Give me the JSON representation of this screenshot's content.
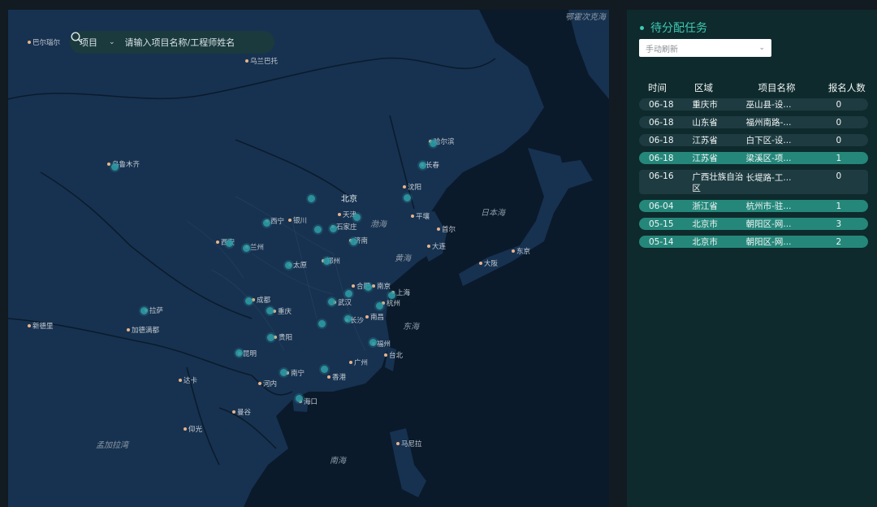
{
  "search": {
    "type_label": "项目",
    "placeholder": "请输入项目名称/工程师姓名"
  },
  "panel": {
    "title": "待分配任务",
    "refresh_select": "手动刷新",
    "columns": [
      "时间",
      "区域",
      "项目名称",
      "报名人数"
    ],
    "rows": [
      {
        "date": "06-18",
        "region": "重庆市",
        "project": "巫山县-设...",
        "count": "0",
        "highlight": false
      },
      {
        "date": "06-18",
        "region": "山东省",
        "project": "福州南路-...",
        "count": "0",
        "highlight": false
      },
      {
        "date": "06-18",
        "region": "江苏省",
        "project": "白下区-设...",
        "count": "0",
        "highlight": false
      },
      {
        "date": "06-18",
        "region": "江苏省",
        "project": "梁溪区-项...",
        "count": "1",
        "highlight": true
      },
      {
        "date": "06-16",
        "region": "广西壮族自治区",
        "project": "长堤路-工...",
        "count": "0",
        "highlight": false
      },
      {
        "date": "06-04",
        "region": "浙江省",
        "project": "杭州市-驻...",
        "count": "1",
        "highlight": true
      },
      {
        "date": "05-15",
        "region": "北京市",
        "project": "朝阳区-网...",
        "count": "3",
        "highlight": true
      },
      {
        "date": "05-14",
        "region": "北京市",
        "project": "朝阳区-网...",
        "count": "2",
        "highlight": true
      }
    ]
  },
  "map": {
    "labels": [
      {
        "text": "巴尔瑙尔",
        "dot": true
      },
      {
        "text": "乌兰巴托",
        "dot": true
      },
      {
        "text": "乌鲁木齐",
        "dot": true
      },
      {
        "text": "北京",
        "dot": false,
        "capital": true
      },
      {
        "text": "天津",
        "dot": true
      },
      {
        "text": "石家庄",
        "dot": true
      },
      {
        "text": "哈尔滨",
        "dot": true
      },
      {
        "text": "长春",
        "dot": true
      },
      {
        "text": "沈阳",
        "dot": true
      },
      {
        "text": "大连",
        "dot": true
      },
      {
        "text": "平壤",
        "dot": true
      },
      {
        "text": "首尔",
        "dot": true
      },
      {
        "text": "东京",
        "dot": true
      },
      {
        "text": "大阪",
        "dot": true
      },
      {
        "text": "济南",
        "dot": true
      },
      {
        "text": "郑州",
        "dot": true
      },
      {
        "text": "太原",
        "dot": true
      },
      {
        "text": "西安",
        "dot": true
      },
      {
        "text": "兰州",
        "dot": true
      },
      {
        "text": "西宁",
        "dot": true
      },
      {
        "text": "银川",
        "dot": true
      },
      {
        "text": "合肥",
        "dot": true
      },
      {
        "text": "南京",
        "dot": true
      },
      {
        "text": "上海",
        "dot": true
      },
      {
        "text": "杭州",
        "dot": true
      },
      {
        "text": "武汉",
        "dot": true
      },
      {
        "text": "成都",
        "dot": true
      },
      {
        "text": "重庆",
        "dot": true
      },
      {
        "text": "长沙",
        "dot": true
      },
      {
        "text": "南昌",
        "dot": true
      },
      {
        "text": "福州",
        "dot": true
      },
      {
        "text": "贵阳",
        "dot": true
      },
      {
        "text": "昆明",
        "dot": true
      },
      {
        "text": "南宁",
        "dot": true
      },
      {
        "text": "广州",
        "dot": true
      },
      {
        "text": "香港",
        "dot": true
      },
      {
        "text": "海口",
        "dot": true
      },
      {
        "text": "拉萨",
        "dot": true
      },
      {
        "text": "台北",
        "dot": true
      },
      {
        "text": "河内",
        "dot": true
      },
      {
        "text": "曼谷",
        "dot": true
      },
      {
        "text": "马尼拉",
        "dot": true
      },
      {
        "text": "加德满都",
        "dot": true
      },
      {
        "text": "新德里",
        "dot": true
      },
      {
        "text": "达卡",
        "dot": true
      },
      {
        "text": "仰光",
        "dot": true
      },
      {
        "text": "渤海",
        "dot": false,
        "big": true
      },
      {
        "text": "黄海",
        "dot": false,
        "big": true
      },
      {
        "text": "东海",
        "dot": false,
        "big": true
      },
      {
        "text": "南海",
        "dot": false,
        "big": true
      },
      {
        "text": "日本海",
        "dot": false,
        "big": true
      },
      {
        "text": "孟加拉湾",
        "dot": false,
        "big": true
      },
      {
        "text": "鄂霍次克海",
        "dot": false,
        "big": true
      }
    ],
    "markers": 30
  }
}
